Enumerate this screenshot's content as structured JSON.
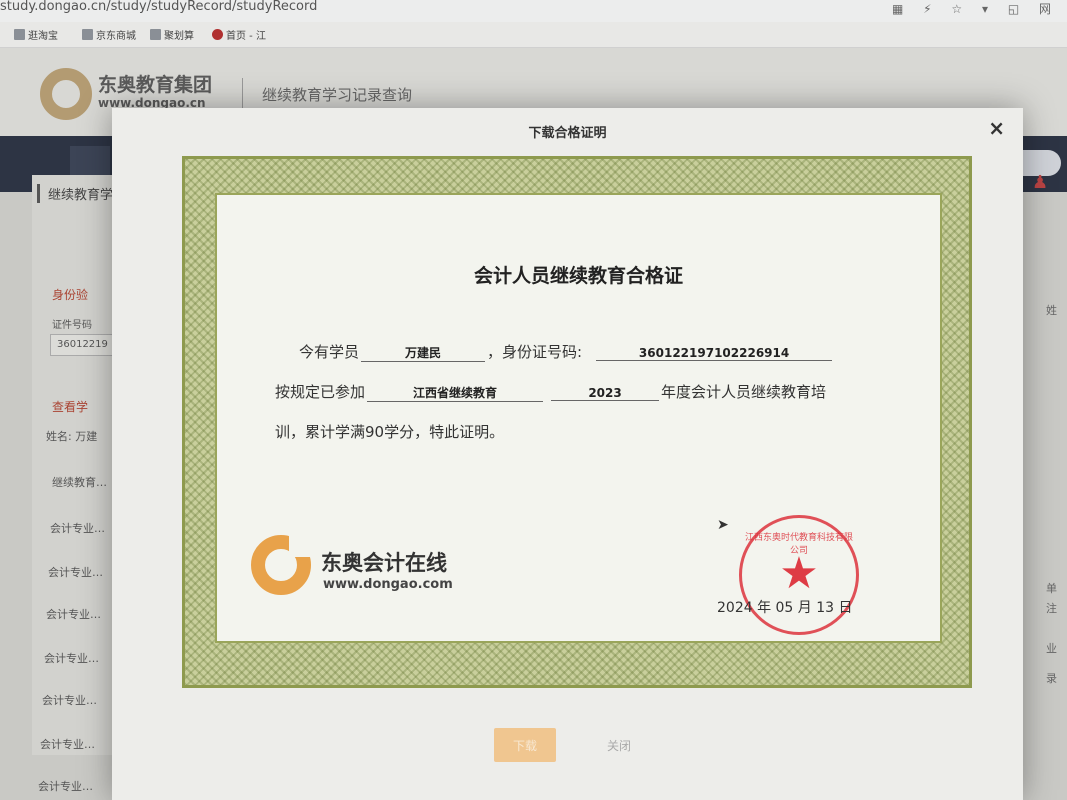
{
  "browser": {
    "url": "study.dongao.cn/study/studyRecord/studyRecord",
    "icons": "▦ ⚡ ☆ ▾ ◱ 网",
    "bookmarks": [
      {
        "label": "逛淘宝"
      },
      {
        "label": "京东商城"
      },
      {
        "label": "聚划算"
      },
      {
        "label": "首页 - 江"
      }
    ]
  },
  "site": {
    "brand": "东奥教育集团",
    "brand_url": "www.dongao.cn",
    "header_title": "继续教育学习记录查询"
  },
  "sidebar": {
    "title": "继续教育学",
    "identity_label": "身份验",
    "cert_no_label": "证件号码",
    "cert_no_value": "36012219",
    "query_label": "查看学",
    "name_row": "姓名:  万建",
    "records": [
      "继续教育…",
      "会计专业…",
      "会计专业…",
      "会计专业…",
      "会计专业…",
      "会计专业…",
      "会计专业…",
      "会计专业…"
    ]
  },
  "right_fragments": [
    "姓",
    "单",
    "注",
    "业",
    "录"
  ],
  "modal": {
    "title": "下载合格证明",
    "close_symbol": "×",
    "download_label": "下载",
    "close_label": "关闭"
  },
  "certificate": {
    "title": "会计人员继续教育合格证",
    "line1_prefix": "今有学员",
    "student_name": "万建民",
    "line1_mid": "，身份证号码:",
    "id_number": "360122197102226914",
    "line2_prefix": "按规定已参加",
    "program": "江西省继续教育",
    "year": "2023",
    "line2_suffix": "年度会计人员继续教育培",
    "line3": "训，累计学满90学分，特此证明。",
    "issuer_name": "东奥会计在线",
    "issuer_url": "www.dongao.com",
    "date": "2024 年 05 月 13 日",
    "seal_star": "★",
    "seal_text": "江西东奥时代教育科技有限公司"
  }
}
